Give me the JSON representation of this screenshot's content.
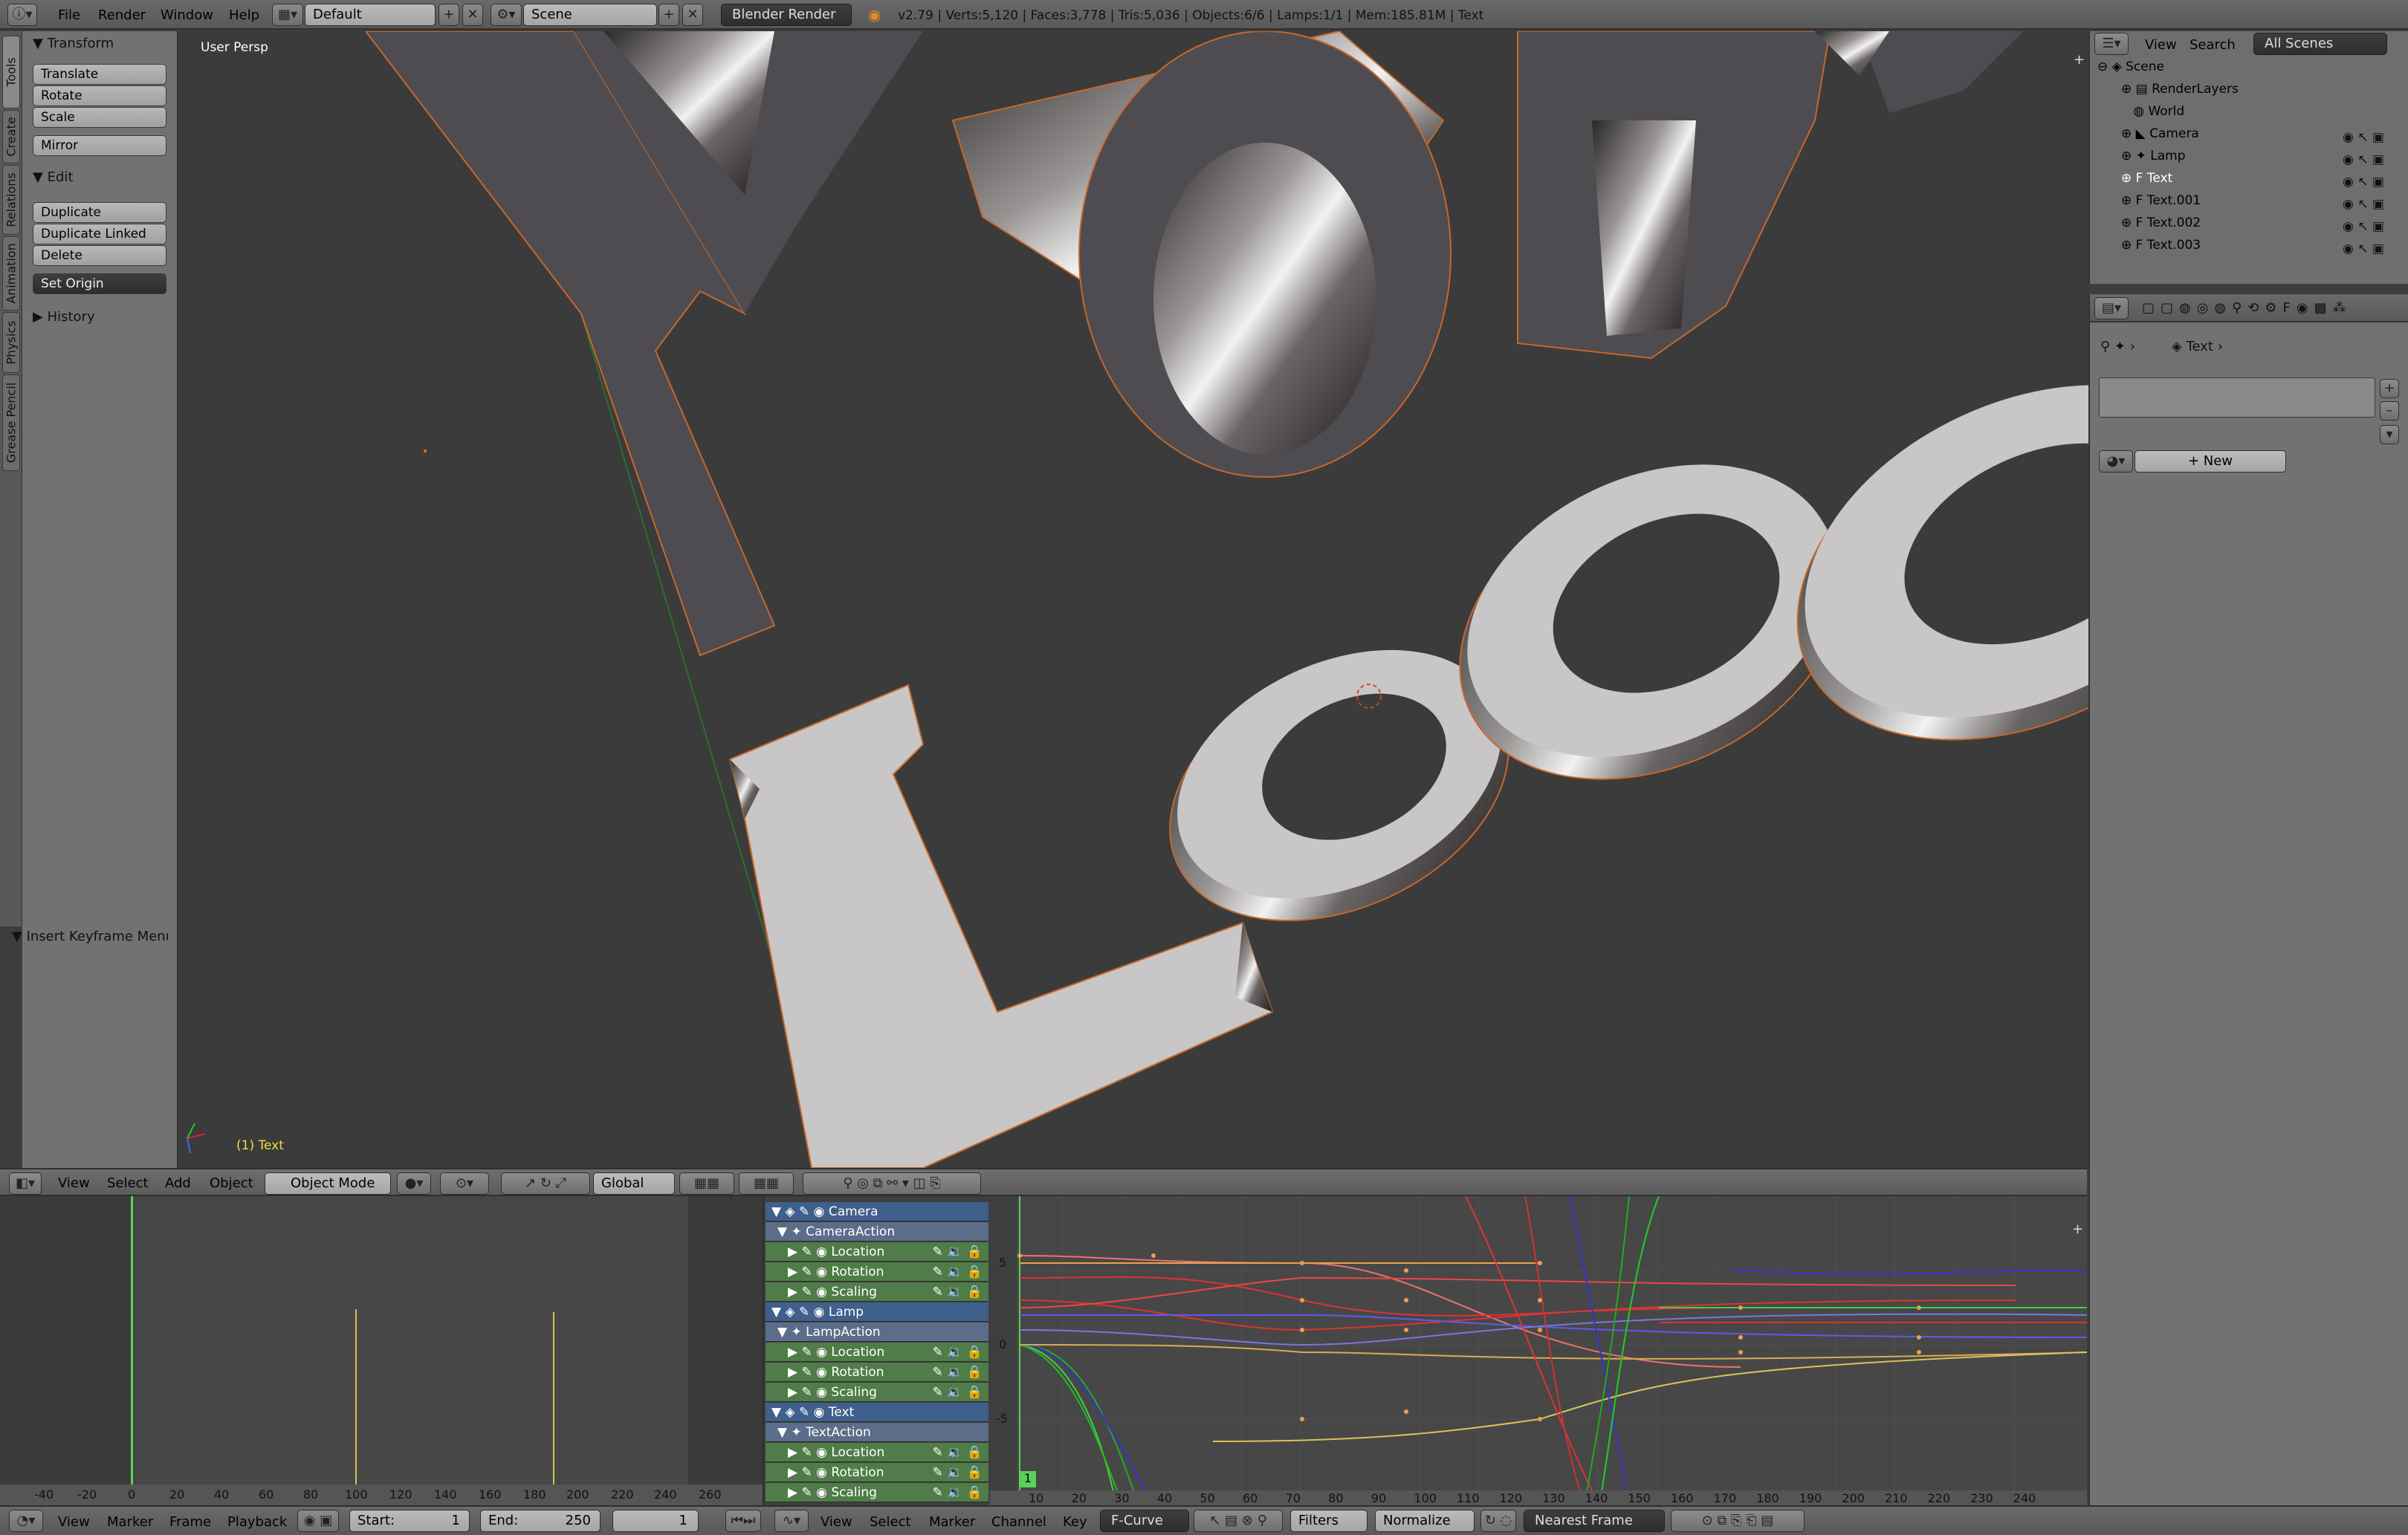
{
  "top": {
    "menus": [
      "File",
      "Render",
      "Window",
      "Help"
    ],
    "layout": "Default",
    "scene": "Scene",
    "engine": "Blender Render",
    "status": "v2.79 | Verts:5,120 | Faces:3,778 | Tris:5,036 | Objects:6/6 | Lamps:1/1 | Mem:185.81M | Text"
  },
  "tabs": [
    "Tools",
    "Create",
    "Relations",
    "Animation",
    "Physics",
    "Grease Pencil"
  ],
  "toolshelf": {
    "transform": "Transform",
    "translate": "Translate",
    "rotate": "Rotate",
    "scale": "Scale",
    "mirror": "Mirror",
    "edit": "Edit",
    "duplicate": "Duplicate",
    "duplicate_linked": "Duplicate Linked",
    "delete": "Delete",
    "set_origin": "Set Origin",
    "history": "History",
    "insert_keyframe": "Insert Keyframe Menu"
  },
  "viewport": {
    "label": "User Persp",
    "object_label": "(1) Text",
    "logo_top": "Your",
    "logo_bottom": "LoGo"
  },
  "vp_header": {
    "menus": [
      "View",
      "Select",
      "Add",
      "Object"
    ],
    "mode": "Object Mode",
    "orientation": "Global"
  },
  "outliner": {
    "view": "View",
    "search": "Search",
    "filter": "All Scenes",
    "items": [
      "Scene",
      "RenderLayers",
      "World",
      "Camera",
      "Lamp",
      "Text",
      "Text.001",
      "Text.002",
      "Text.003"
    ]
  },
  "props": {
    "breadcrumb": "Text",
    "new_button": "New"
  },
  "timeline": {
    "ticks": [
      "-40",
      "-20",
      "0",
      "20",
      "40",
      "60",
      "80",
      "100",
      "120",
      "140",
      "160",
      "180",
      "200",
      "220",
      "240",
      "260"
    ],
    "menus": [
      "View",
      "Marker",
      "Frame",
      "Playback"
    ],
    "start": "Start:",
    "start_val": "1",
    "end": "End:",
    "end_val": "250",
    "current": "1"
  },
  "channels": [
    {
      "label": "Camera",
      "kind": "obj"
    },
    {
      "label": "CameraAction",
      "kind": "act"
    },
    {
      "label": "Location",
      "kind": "fc"
    },
    {
      "label": "Rotation",
      "kind": "fc"
    },
    {
      "label": "Scaling",
      "kind": "fc"
    },
    {
      "label": "Lamp",
      "kind": "obj"
    },
    {
      "label": "LampAction",
      "kind": "act"
    },
    {
      "label": "Location",
      "kind": "fc"
    },
    {
      "label": "Rotation",
      "kind": "fc"
    },
    {
      "label": "Scaling",
      "kind": "fc"
    },
    {
      "label": "Text",
      "kind": "obj"
    },
    {
      "label": "TextAction",
      "kind": "act"
    },
    {
      "label": "Location",
      "kind": "fc"
    },
    {
      "label": "Rotation",
      "kind": "fc"
    },
    {
      "label": "Scaling",
      "kind": "fc"
    }
  ],
  "graph": {
    "ticks": [
      "10",
      "20",
      "30",
      "40",
      "50",
      "60",
      "70",
      "80",
      "90",
      "100",
      "110",
      "120",
      "130",
      "140",
      "150",
      "160",
      "170",
      "180",
      "190",
      "200",
      "210",
      "220",
      "230",
      "240"
    ],
    "y_labels": [
      "5",
      "0",
      "-5"
    ],
    "frame": "1",
    "menus": [
      "View",
      "Select",
      "Marker",
      "Channel",
      "Key"
    ],
    "mode": "F-Curve",
    "filters": "Filters",
    "normalize": "Normalize",
    "snap": "Nearest Frame"
  }
}
